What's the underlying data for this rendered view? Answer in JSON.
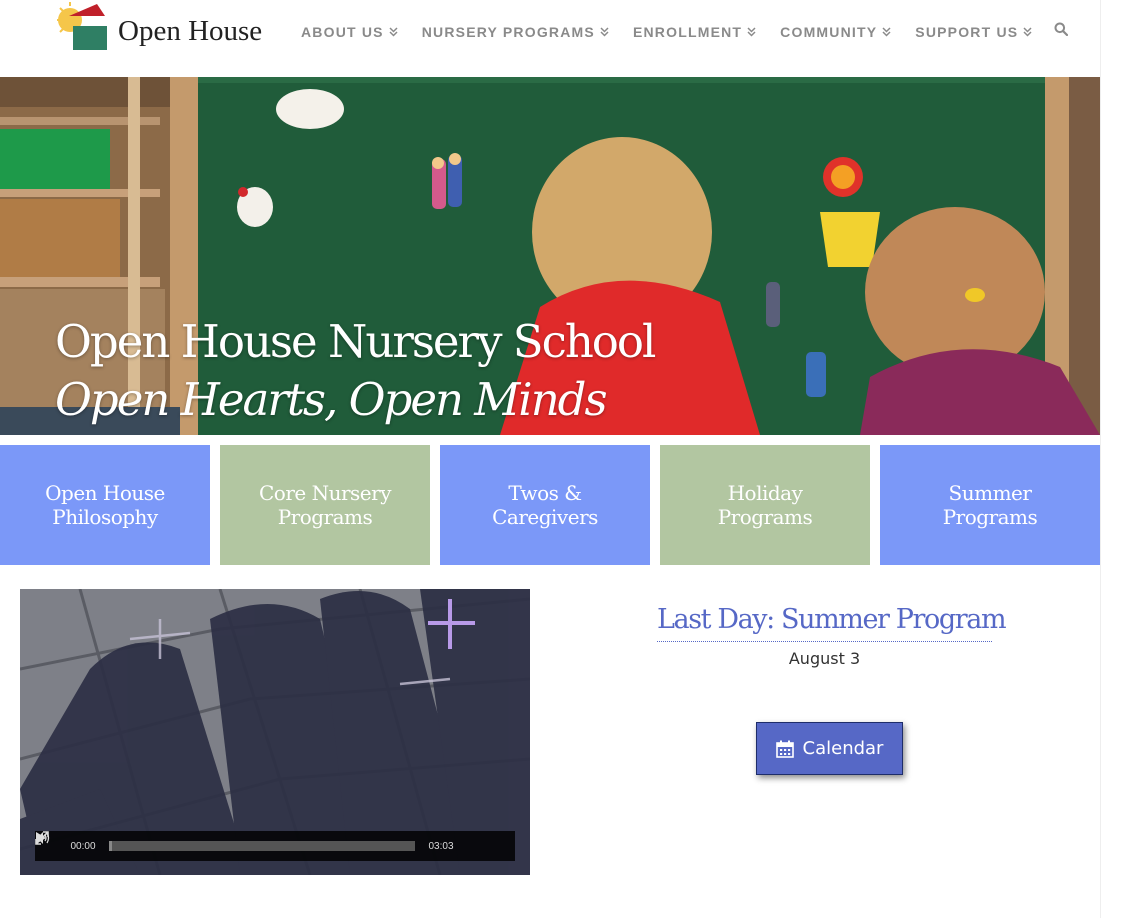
{
  "header": {
    "logo_text": "Open House",
    "nav": [
      {
        "label": "ABOUT US"
      },
      {
        "label": "NURSERY PROGRAMS"
      },
      {
        "label": "ENROLLMENT"
      },
      {
        "label": "COMMUNITY"
      },
      {
        "label": "SUPPORT US"
      }
    ],
    "search_icon": "search-icon"
  },
  "hero": {
    "title": "Open House Nursery School",
    "tagline": "Open Hearts, Open Minds"
  },
  "tiles": [
    {
      "label": "Open House Philosophy",
      "color": "#7b98f8"
    },
    {
      "label": "Core Nursery Programs",
      "color": "#b2c6a1"
    },
    {
      "label": "Twos & Caregivers",
      "color": "#7b98f8"
    },
    {
      "label": "Holiday Programs",
      "color": "#b2c6a1"
    },
    {
      "label": "Summer Programs",
      "color": "#7b98f8"
    }
  ],
  "video": {
    "current_time": "00:00",
    "duration": "03:03",
    "progress": 0.0
  },
  "event": {
    "title": "Last Day: Summer Program",
    "date": "August 3"
  },
  "calendar_button": {
    "label": "Calendar",
    "icon": "calendar-icon"
  },
  "colors": {
    "accent": "#5668c6",
    "tile_blue": "#7b98f8",
    "tile_green": "#b2c6a1",
    "nav_text": "#8a8a8a"
  }
}
